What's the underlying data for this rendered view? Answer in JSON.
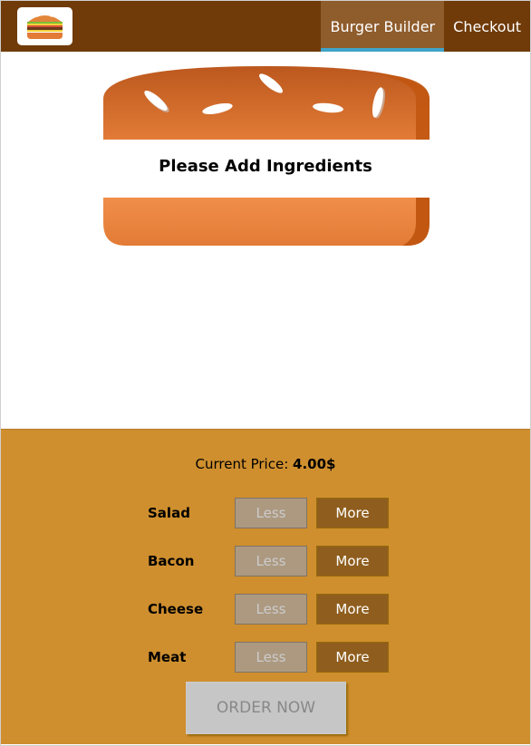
{
  "toolbar": {
    "logo_icon": "burger-logo-icon",
    "nav": [
      {
        "label": "Burger Builder",
        "active": true
      },
      {
        "label": "Checkout",
        "active": false
      }
    ]
  },
  "burger": {
    "message": "Please Add Ingredients"
  },
  "controls": {
    "price_label": "Current Price:",
    "price_value": "4.00$",
    "items": [
      {
        "label": "Salad",
        "less": "Less",
        "more": "More"
      },
      {
        "label": "Bacon",
        "less": "Less",
        "more": "More"
      },
      {
        "label": "Cheese",
        "less": "Less",
        "more": "More"
      },
      {
        "label": "Meat",
        "less": "Less",
        "more": "More"
      }
    ],
    "order_label": "ORDER NOW"
  },
  "colors": {
    "toolbar": "#703B09",
    "nav_active": "#8F5C2C",
    "nav_active_border": "#40A4C8",
    "controls_bg": "#CF8F2E",
    "bread": "#E27B36",
    "less_btn": "#AC9980",
    "more_btn": "#8F5E1E",
    "order_btn": "#C7C6C6"
  }
}
